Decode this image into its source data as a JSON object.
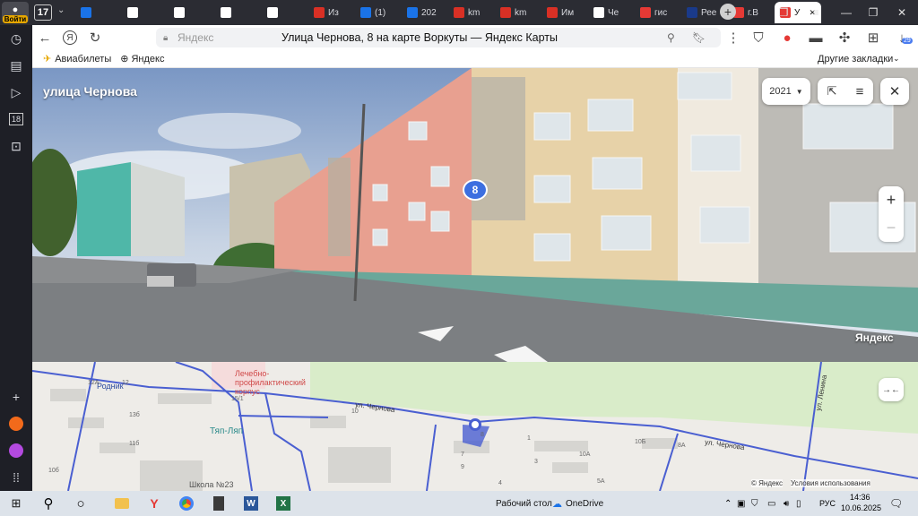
{
  "browser": {
    "login_label": "Войти",
    "tab_count": "17",
    "tabs": [
      {
        "label": "",
        "icon": "yandex-icon",
        "color": "#1a73e8"
      },
      {
        "label": "",
        "icon": "doc-icon",
        "color": "#ffffff"
      },
      {
        "label": "",
        "icon": "doc-icon",
        "color": "#ffffff"
      },
      {
        "label": "",
        "icon": "doc-icon",
        "color": "#ffffff"
      },
      {
        "label": "",
        "icon": "doc-icon",
        "color": "#ffffff"
      },
      {
        "label": "Из",
        "icon": "pdf-icon",
        "color": "#d93025"
      },
      {
        "label": "(1)",
        "icon": "mail-icon",
        "color": "#1a73e8"
      },
      {
        "label": "202",
        "icon": "calendar-icon",
        "color": "#1a73e8"
      },
      {
        "label": "km",
        "icon": "pdf-icon",
        "color": "#d93025"
      },
      {
        "label": "km",
        "icon": "pdf-icon",
        "color": "#d93025"
      },
      {
        "label": "Им",
        "icon": "pdf-icon",
        "color": "#d93025"
      },
      {
        "label": "Че",
        "icon": "doc-icon",
        "color": "#ffffff"
      },
      {
        "label": "гис",
        "icon": "yandex-icon",
        "color": "#e53935"
      },
      {
        "label": "Рее",
        "icon": "gov-icon",
        "color": "#1a3a8a"
      },
      {
        "label": "г.В",
        "icon": "yandex-icon",
        "color": "#e53935"
      },
      {
        "label": "У",
        "icon": "map-pin-icon",
        "color": "#e53935",
        "active": true
      }
    ],
    "url_domain": "Яндекс",
    "page_title": "Улица Чернова, 8 на карте Воркуты — Яндекс Карты",
    "download_badge": "29",
    "bookmarks": [
      {
        "label": "Авиабилеты",
        "icon": "plane-icon"
      },
      {
        "label": "Яндекс",
        "icon": "plus-icon"
      }
    ],
    "other_bookmarks": "Другие закладки"
  },
  "panorama": {
    "street_label": "улица Чернова",
    "year": "2021",
    "house_number": "8",
    "watermark": "Яндекс"
  },
  "map": {
    "labels": {
      "hospital": "Лечебно-\nпрофилактический\nкорпус",
      "rodnik": "Родник",
      "tyap_lyap": "Тяп-Ляп",
      "school": "Школа №23",
      "street1": "ул. Чернова",
      "street2": "ул. Чернова",
      "lenina": "ул. Ленина"
    },
    "house_numbers": [
      "12А",
      "12",
      "15/1",
      "13б",
      "11б",
      "10б",
      "10",
      "8",
      "10А",
      "10Б",
      "9",
      "1",
      "3",
      "5А",
      "4",
      "7",
      "8А"
    ],
    "copyright": "© Яндекс",
    "terms": "Условия использования"
  },
  "taskbar": {
    "desktop_label": "Рабочий стол",
    "onedrive_label": "OneDrive",
    "lang": "РУС",
    "time": "14:36",
    "date": "10.06.2025"
  },
  "colors": {
    "street_blue": "#4a5fd1",
    "accent_red": "#e53935"
  }
}
